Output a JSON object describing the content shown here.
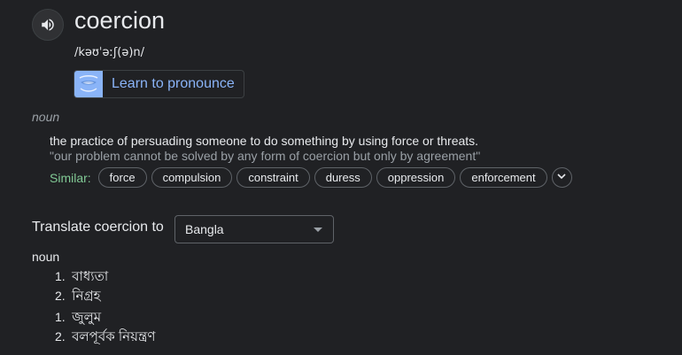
{
  "header": {
    "word": "coercion",
    "phonetic": "/kəʊˈəːʃ(ə)n/",
    "learn_label": "Learn to pronounce"
  },
  "definitions": {
    "part_of_speech": "noun",
    "definition": "the practice of persuading someone to do something by using force or threats.",
    "example": "\"our problem cannot be solved by any form of coercion but only by agreement\"",
    "similar_label": "Similar:",
    "similar": [
      "force",
      "compulsion",
      "constraint",
      "duress",
      "oppression",
      "enforcement"
    ]
  },
  "translate": {
    "label": "Translate coercion to",
    "language": "Bangla",
    "part_of_speech": "noun",
    "groups": [
      [
        {
          "num": "1.",
          "text": "বাধ্যতা"
        },
        {
          "num": "2.",
          "text": "নিগ্রহ"
        }
      ],
      [
        {
          "num": "1.",
          "text": "জুলুম"
        },
        {
          "num": "2.",
          "text": "বলপূর্বক নিয়ন্ত্রণ"
        }
      ]
    ]
  },
  "colors": {
    "background": "#202124",
    "link_blue": "#8ab4f8",
    "similar_green": "#81c995",
    "muted_text": "#9aa0a6"
  },
  "icons": {
    "speaker": "speaker-icon",
    "learn": "mouth-icon",
    "expand": "chevron-down-icon",
    "dropdown": "caret-down-icon"
  }
}
